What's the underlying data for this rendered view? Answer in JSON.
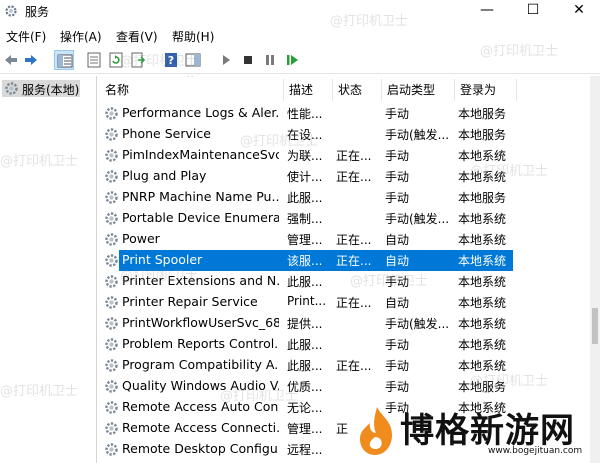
{
  "window": {
    "title": "服务",
    "minimize": "—",
    "maximize": "☐",
    "close": "✕"
  },
  "menu": {
    "items": [
      "文件(F)",
      "操作(A)",
      "查看(V)",
      "帮助(H)"
    ]
  },
  "tree": {
    "root_label": "服务(本地)"
  },
  "list": {
    "columns": {
      "name": "名称",
      "desc": "描述",
      "status": "状态",
      "startup": "启动类型",
      "logon": "登录为"
    },
    "rows": [
      {
        "name": "Performance Logs & Aler...",
        "desc": "性能...",
        "status": "",
        "startup": "手动",
        "logon": "本地服务"
      },
      {
        "name": "Phone Service",
        "desc": "在设...",
        "status": "",
        "startup": "手动(触发...",
        "logon": "本地服务"
      },
      {
        "name": "PimIndexMaintenanceSvc...",
        "desc": "为联...",
        "status": "正在...",
        "startup": "手动",
        "logon": "本地系统"
      },
      {
        "name": "Plug and Play",
        "desc": "使计...",
        "status": "正在...",
        "startup": "手动",
        "logon": "本地系统"
      },
      {
        "name": "PNRP Machine Name Pu...",
        "desc": "此服...",
        "status": "",
        "startup": "手动",
        "logon": "本地服务"
      },
      {
        "name": "Portable Device Enumera...",
        "desc": "强制...",
        "status": "",
        "startup": "手动(触发...",
        "logon": "本地系统"
      },
      {
        "name": "Power",
        "desc": "管理...",
        "status": "正在...",
        "startup": "自动",
        "logon": "本地系统"
      },
      {
        "name": "Print Spooler",
        "desc": "该服...",
        "status": "正在...",
        "startup": "自动",
        "logon": "本地系统",
        "selected": true
      },
      {
        "name": "Printer Extensions and N...",
        "desc": "此服...",
        "status": "",
        "startup": "手动",
        "logon": "本地系统"
      },
      {
        "name": "Printer Repair Service",
        "desc": "Print...",
        "status": "正在...",
        "startup": "自动",
        "logon": "本地系统"
      },
      {
        "name": "PrintWorkflowUserSvc_68...",
        "desc": "提供...",
        "status": "",
        "startup": "手动(触发...",
        "logon": "本地系统"
      },
      {
        "name": "Problem Reports Control...",
        "desc": "此服...",
        "status": "",
        "startup": "手动",
        "logon": "本地系统"
      },
      {
        "name": "Program Compatibility A...",
        "desc": "此服...",
        "status": "正在...",
        "startup": "手动",
        "logon": "本地系统"
      },
      {
        "name": "Quality Windows Audio V...",
        "desc": "优质...",
        "status": "",
        "startup": "手动",
        "logon": "本地服务"
      },
      {
        "name": "Remote Access Auto Con...",
        "desc": "无论...",
        "status": "",
        "startup": "手动",
        "logon": "本地系统"
      },
      {
        "name": "Remote Access Connecti...",
        "desc": "管理...",
        "status": "正",
        "startup": "",
        "logon": ""
      },
      {
        "name": "Remote Desktop Configu...",
        "desc": "远程...",
        "status": "",
        "startup": "",
        "logon": ""
      }
    ]
  },
  "watermark": {
    "text": "@打印机卫士"
  },
  "logo": {
    "text": "博格新游网",
    "url": "www.bogejituan.com"
  },
  "colors": {
    "selection": "#0078d7",
    "tree_selection": "#d9d9d9",
    "toolbar_selected": "#cce4f7",
    "logo_orange": "#f08c1e"
  }
}
